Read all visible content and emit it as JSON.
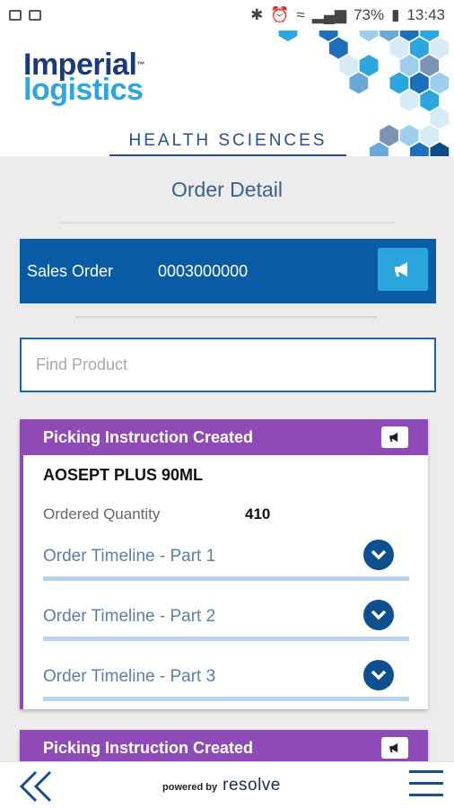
{
  "status_bar": {
    "battery": "73%",
    "time": "13:43"
  },
  "header": {
    "logo_line1": "Imperial",
    "logo_tm": "™",
    "logo_line2": "logistics",
    "tagline": "HEALTH SCIENCES"
  },
  "page": {
    "title": "Order Detail"
  },
  "order": {
    "label": "Sales Order",
    "number": "0003000000"
  },
  "search": {
    "placeholder": "Find Product",
    "value": ""
  },
  "cards": [
    {
      "status": "Picking Instruction Created",
      "product": "AOSEPT PLUS 90ML",
      "qty_label": "Ordered Quantity",
      "qty_value": "410",
      "timelines": [
        "Order Timeline - Part 1",
        "Order Timeline - Part 2",
        "Order Timeline - Part 3"
      ]
    },
    {
      "status": "Picking Instruction Created"
    }
  ],
  "footer": {
    "powered_by": "powered by",
    "brand": "resolve"
  },
  "colors": {
    "primary": "#0a5ba6",
    "accent": "#2aa6dd",
    "card_header": "#8e4bb8",
    "timeline_line": "#b8d3ea"
  },
  "icons": [
    "image-icon",
    "outlook-icon",
    "bluetooth-icon",
    "alarm-icon",
    "wifi-icon",
    "signal-icon",
    "battery-icon",
    "megaphone-icon",
    "chevron-down-icon",
    "double-chevron-left-icon",
    "hamburger-menu-icon"
  ]
}
